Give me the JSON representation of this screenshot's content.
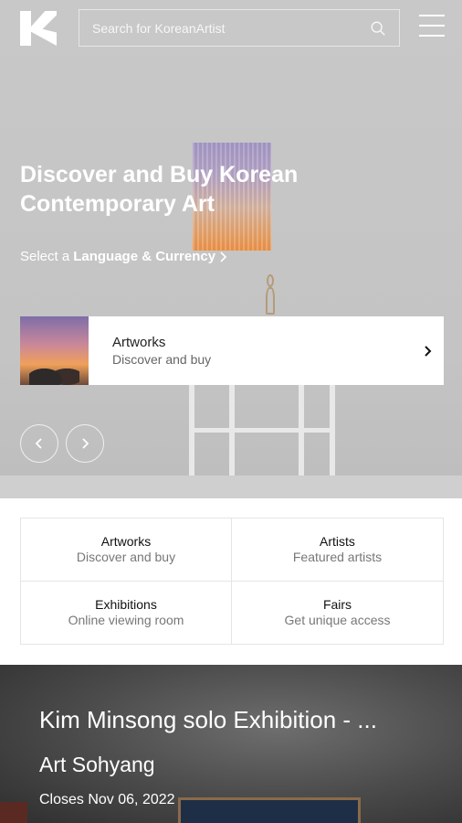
{
  "header": {
    "search_placeholder": "Search for KoreanArtist"
  },
  "hero": {
    "title": "Discover and Buy Korean Contemporary Art",
    "language_prefix": "Select a",
    "language_link": "Language & Currency",
    "feature_card": {
      "title": "Artworks",
      "subtitle": "Discover and buy"
    }
  },
  "categories": [
    {
      "title": "Artworks",
      "subtitle": "Discover and buy"
    },
    {
      "title": "Artists",
      "subtitle": "Featured artists"
    },
    {
      "title": "Exhibitions",
      "subtitle": "Online viewing room"
    },
    {
      "title": "Fairs",
      "subtitle": "Get unique access"
    }
  ],
  "exhibition": {
    "title": "Kim Minsong solo Exhibition - ...",
    "gallery": "Art Sohyang",
    "closes": "Closes Nov 06, 2022"
  },
  "icons": {
    "logo": "korean-artist-logo",
    "search": "search-icon",
    "menu": "hamburger-menu-icon",
    "prev": "chevron-left-icon",
    "next": "chevron-right-icon"
  }
}
